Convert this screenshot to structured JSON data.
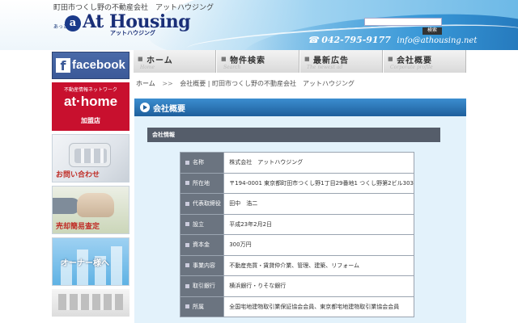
{
  "header": {
    "tagline": "町田市つくし野の不動産会社　アットハウジング",
    "logo_prefix": "あっと",
    "logo_brand": "At Housing",
    "logo_kana": "アットハウジング",
    "search_placeholder": "",
    "search_button": "検索",
    "tel": "042-795-9177",
    "email": "info@athousing.net"
  },
  "global_nav": [
    {
      "label": "ホーム",
      "sub": "Home"
    },
    {
      "label": "物件検索",
      "sub": "Search"
    },
    {
      "label": "最新広告",
      "sub": "The newest ad"
    },
    {
      "label": "会社概要",
      "sub": "Corporate profile"
    }
  ],
  "sidebar": {
    "facebook": "facebook",
    "athome_top": "不動産情報ネットワーク",
    "athome_logo": "at·home",
    "athome_bottom": "加盟店",
    "contact": "お問い合わせ",
    "sale": "売却簡易査定",
    "owner": "オーナー様へ"
  },
  "breadcrumb": {
    "home": "ホーム",
    "sep": ">>",
    "current": "会社概要 | 町田市つくし野の不動産会社　アットハウジング"
  },
  "heading": "会社概要",
  "section_title": "会社情報",
  "company_info": [
    {
      "label": "名称",
      "value": "株式会社　アットハウジング"
    },
    {
      "label": "所在地",
      "value": "〒194-0001 東京都町田市つくし野1丁目29番地1 つくし野第2ビル303"
    },
    {
      "label": "代表取締役",
      "value": "田中　浩二"
    },
    {
      "label": "設立",
      "value": "平成23年2月2日"
    },
    {
      "label": "資本金",
      "value": "300万円"
    },
    {
      "label": "事業内容",
      "value": "不動産売買・賃貸仲介業、管理、建築、リフォーム"
    },
    {
      "label": "取引銀行",
      "value": "横浜銀行・りそな銀行"
    },
    {
      "label": "所属",
      "value": "全国宅地建物取引業保証協会会員、東京都宅地建物取引業協会会員"
    }
  ],
  "colors": {
    "header_blue": "#3796d6",
    "heading_bar": "#1e5f9c",
    "panel_bg": "#e3f2fb",
    "table_header": "#6b7480",
    "athome_red": "#c8102e",
    "facebook_blue": "#3b5998"
  }
}
